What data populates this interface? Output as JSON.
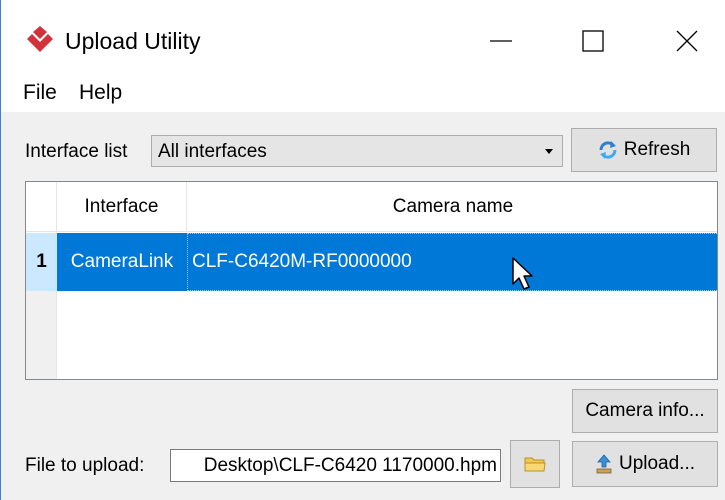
{
  "window": {
    "title": "Upload Utility",
    "controls": {
      "minimize": "minimize-icon",
      "maximize": "maximize-icon",
      "close": "close-icon"
    }
  },
  "menu": {
    "items": [
      "File",
      "Help"
    ]
  },
  "interface_list": {
    "label": "Interface list",
    "selected": "All interfaces"
  },
  "buttons": {
    "refresh": "Refresh",
    "camera_info": "Camera info...",
    "upload": "Upload..."
  },
  "table": {
    "columns": [
      "Interface",
      "Camera name"
    ],
    "rows": [
      {
        "index": "1",
        "interface": "CameraLink",
        "camera_name": "CLF-C6420M-RF0000000",
        "selected": true
      }
    ]
  },
  "file_upload": {
    "label": "File to upload:",
    "value": "Desktop\\CLF-C6420 1170000.hpm"
  },
  "colors": {
    "selection": "#0078d7",
    "row_header_selected": "#cce8ff",
    "logo": "#d2333a",
    "button_face": "#e1e1e1",
    "window_border": "#3f7fd8"
  },
  "icons": {
    "logo": "app-logo-icon",
    "refresh": "refresh-icon",
    "folder": "folder-icon",
    "upload": "upload-icon",
    "cursor": "mouse-cursor-icon"
  }
}
